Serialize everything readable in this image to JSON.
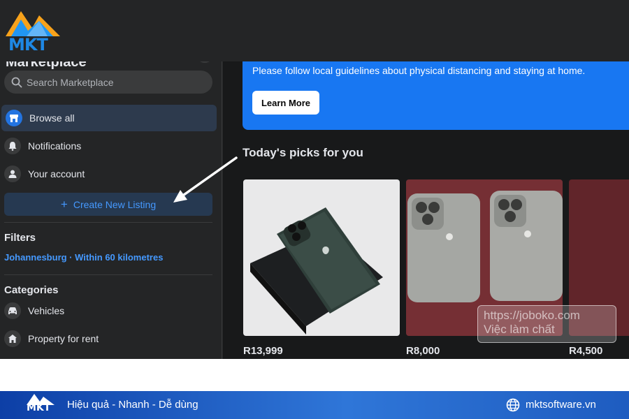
{
  "brand": {
    "logo_text": "MKT"
  },
  "sidebar": {
    "title": "Marketplace",
    "search": {
      "placeholder": "Search Marketplace",
      "value": ""
    },
    "nav": [
      {
        "label": "Browse all",
        "icon": "storefront-icon",
        "active": true
      },
      {
        "label": "Notifications",
        "icon": "bell-icon",
        "active": false
      },
      {
        "label": "Your account",
        "icon": "person-icon",
        "active": false
      }
    ],
    "create_listing": {
      "label": "Create New Listing",
      "icon": "plus-icon"
    },
    "filters": {
      "title": "Filters",
      "location": "Johannesburg · Within 60 kilometres"
    },
    "categories": {
      "title": "Categories",
      "items": [
        {
          "label": "Vehicles",
          "icon": "car-icon"
        },
        {
          "label": "Property for rent",
          "icon": "house-icon"
        }
      ]
    }
  },
  "main": {
    "banner": {
      "subtitle": "Please follow local guidelines about physical distancing and staying at home.",
      "button_label": "Learn More"
    },
    "picks_title": "Today's picks for you",
    "products": [
      {
        "price": "R13,999",
        "image": "iphone-11-pro-green-in-box"
      },
      {
        "price": "R8,000",
        "image": "two-iphones-on-red-carpet"
      },
      {
        "price": "R4,500",
        "image": "partial-product-red-carpet"
      }
    ],
    "watermark": {
      "line1": "https://joboko.com",
      "line2": "Việc làm chất"
    }
  },
  "footer": {
    "slogan": "Hiệu quả - Nhanh - Dễ dùng",
    "website": "mktsoftware.vn"
  },
  "colors": {
    "facebook_blue": "#1877f2",
    "link_blue": "#4599ff",
    "sidebar_bg": "#242526",
    "footer_gradient_start": "#0d3fa6"
  }
}
